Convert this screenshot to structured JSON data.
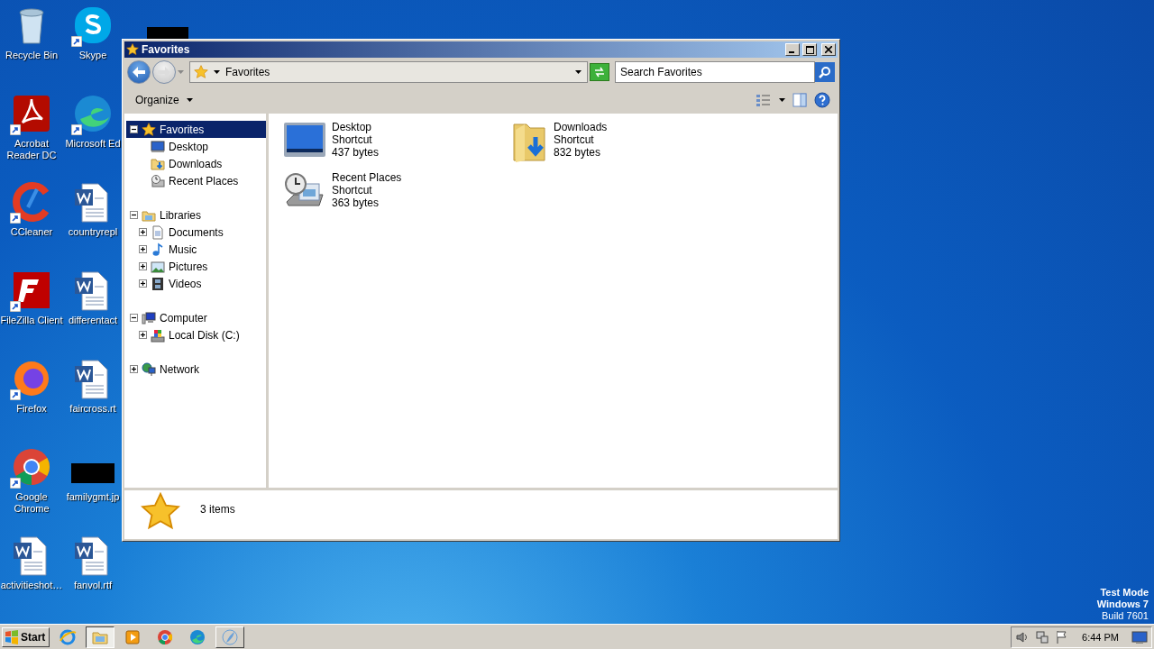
{
  "desktop_icons": [
    {
      "label": "Recycle Bin",
      "kind": "recycle",
      "shortcut": false
    },
    {
      "label": "Acrobat Reader DC",
      "kind": "acrobat",
      "shortcut": true
    },
    {
      "label": "CCleaner",
      "kind": "ccleaner",
      "shortcut": true
    },
    {
      "label": "FileZilla Client",
      "kind": "filezilla",
      "shortcut": true
    },
    {
      "label": "Firefox",
      "kind": "firefox",
      "shortcut": true
    },
    {
      "label": "Google Chrome",
      "kind": "chrome",
      "shortcut": true
    },
    {
      "label": "activitieshot…",
      "kind": "word",
      "shortcut": false
    },
    {
      "label": "Skype",
      "kind": "skype",
      "shortcut": true
    },
    {
      "label": "Microsoft Ed",
      "kind": "edge",
      "shortcut": true
    },
    {
      "label": "countryrepl",
      "kind": "word",
      "shortcut": false
    },
    {
      "label": "differentact",
      "kind": "word",
      "shortcut": false
    },
    {
      "label": "faircross.rt",
      "kind": "word",
      "shortcut": false
    },
    {
      "label": "familygmt.jp",
      "kind": "redacted",
      "shortcut": false
    },
    {
      "label": "fanvol.rtf",
      "kind": "word",
      "shortcut": false
    }
  ],
  "window": {
    "title": "Favorites",
    "address": {
      "path": "Favorites"
    },
    "search": {
      "placeholder": "Search Favorites"
    },
    "toolbar": {
      "organize": "Organize"
    },
    "tree": [
      {
        "label": "Favorites",
        "kind": "star",
        "expanded": true,
        "selected": true,
        "children": [
          {
            "label": "Desktop",
            "kind": "desktop",
            "selected": false
          },
          {
            "label": "Downloads",
            "kind": "downloads",
            "selected": false
          },
          {
            "label": "Recent Places",
            "kind": "recent",
            "selected": false
          }
        ]
      },
      {
        "label": "Libraries",
        "kind": "library",
        "expanded": true,
        "selected": false,
        "children": [
          {
            "label": "Documents",
            "kind": "documents",
            "expanded": false,
            "selected": false
          },
          {
            "label": "Music",
            "kind": "music",
            "expanded": false,
            "selected": false
          },
          {
            "label": "Pictures",
            "kind": "pictures",
            "expanded": false,
            "selected": false
          },
          {
            "label": "Videos",
            "kind": "videos",
            "expanded": false,
            "selected": false
          }
        ]
      },
      {
        "label": "Computer",
        "kind": "computer",
        "expanded": true,
        "selected": false,
        "children": [
          {
            "label": "Local Disk (C:)",
            "kind": "disk",
            "expanded": false,
            "selected": false
          }
        ]
      },
      {
        "label": "Network",
        "kind": "network",
        "expanded": false,
        "selected": false
      }
    ],
    "files": [
      {
        "name": "Desktop",
        "type": "Shortcut",
        "size": "437 bytes",
        "kind": "desktop"
      },
      {
        "name": "Downloads",
        "type": "Shortcut",
        "size": "832 bytes",
        "kind": "downloads"
      },
      {
        "name": "Recent Places",
        "type": "Shortcut",
        "size": "363 bytes",
        "kind": "recent"
      }
    ],
    "details": {
      "count": "3 items"
    }
  },
  "os_notice": [
    "Test Mode",
    "Windows 7",
    "Build 7601"
  ],
  "taskbar": {
    "start": "Start",
    "tasks": [
      {
        "kind": "ie",
        "running": false,
        "selected": false
      },
      {
        "kind": "explorer",
        "running": true,
        "selected": true
      },
      {
        "kind": "media",
        "running": false,
        "selected": false
      },
      {
        "kind": "chrome",
        "running": false,
        "selected": false
      },
      {
        "kind": "edge",
        "running": false,
        "selected": false
      },
      {
        "kind": "feather",
        "running": true,
        "selected": false
      }
    ],
    "clock": "6:44 PM"
  }
}
